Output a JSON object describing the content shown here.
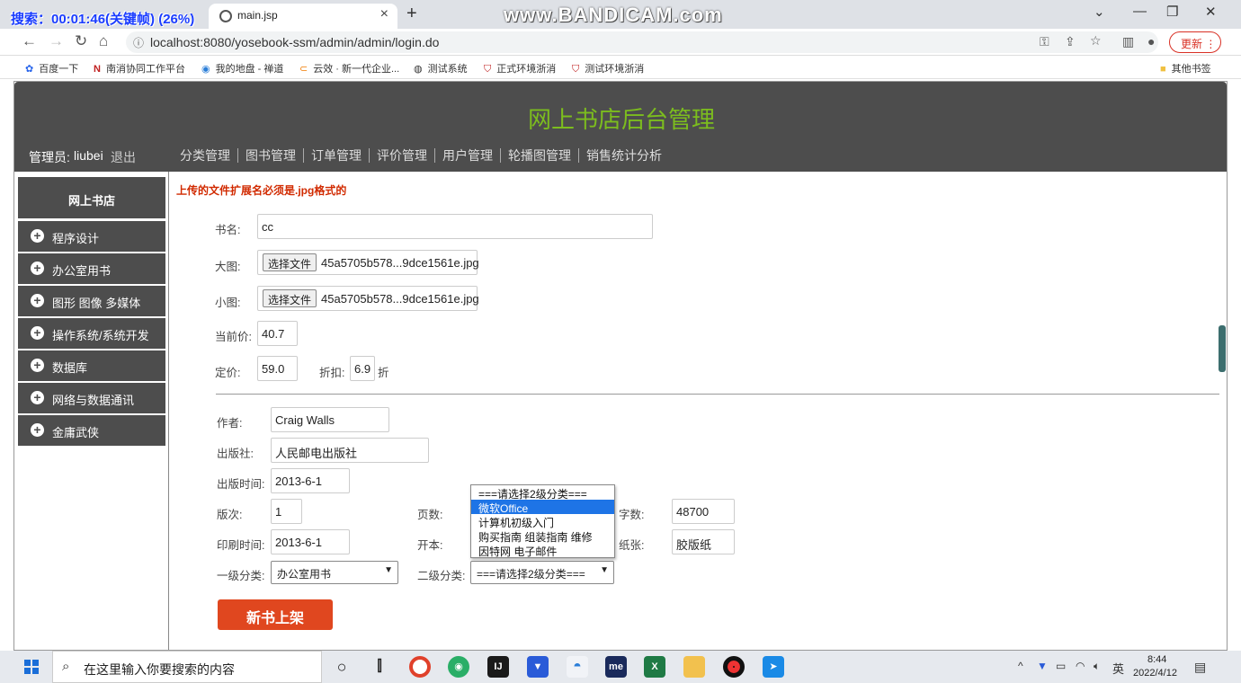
{
  "browser": {
    "recording_overlay": "搜索：00:01:46(关键帧) (26%)",
    "watermark": "www.BANDICAM.com",
    "tab_title": "main.jsp",
    "url": "localhost:8080/yosebook-ssm/admin/admin/login.do",
    "update_label": "更新",
    "bookmarks": [
      "百度一下",
      "南消协同工作平台",
      "我的地盘 - 禅道",
      "云效 · 新一代企业...",
      "测试系统",
      "正式环境浙消",
      "测试环境浙消"
    ],
    "other_bookmarks": "其他书签"
  },
  "header": {
    "title": "网上书店后台管理",
    "admin_label": "管理员:",
    "admin_name": "liubei",
    "logout": "退出",
    "nav": [
      "分类管理",
      "图书管理",
      "订单管理",
      "评价管理",
      "用户管理",
      "轮播图管理",
      "销售统计分析"
    ]
  },
  "sidebar": {
    "title": "网上书店",
    "items": [
      "程序设计",
      "办公室用书",
      "图形 图像 多媒体",
      "操作系统/系统开发",
      "数据库",
      "网络与数据通讯",
      "金庸武侠"
    ]
  },
  "form": {
    "notice": "上传的文件扩展名必须是.jpg格式的",
    "book_name_label": "书名:",
    "book_name": "cc",
    "big_image_label": "大图:",
    "small_image_label": "小图:",
    "choose_file": "选择文件",
    "big_image_file": "45a5705b578...9dce1561e.jpg",
    "small_image_file": "45a5705b578...9dce1561e.jpg",
    "current_price_label": "当前价:",
    "current_price": "40.7",
    "list_price_label": "定价:",
    "list_price": "59.0",
    "discount_label": "折扣:",
    "discount": "6.9",
    "discount_unit": "折",
    "author_label": "作者:",
    "author": "Craig Walls",
    "publisher_label": "出版社:",
    "publisher": "人民邮电出版社",
    "publish_date_label": "出版时间:",
    "publish_date": "2013-6-1",
    "edition_label": "版次:",
    "edition": "1",
    "pages_label": "页数:",
    "words_label": "字数:",
    "words": "48700",
    "print_date_label": "印刷时间:",
    "print_date": "2013-6-1",
    "format_label": "开本:",
    "paper_label": "纸张:",
    "paper": "胶版纸",
    "category1_label": "一级分类:",
    "category1": "办公室用书",
    "category2_label": "二级分类:",
    "category2": "===请选择2级分类===",
    "category2_options": [
      "===请选择2级分类===",
      "微软Office",
      "计算机初级入门",
      "购买指南 组装指南 维修",
      "因特网 电子邮件"
    ],
    "category2_highlighted_index": 1,
    "submit_label": "新书上架"
  },
  "taskbar": {
    "search_placeholder": "在这里输入你要搜索的内容",
    "ime": "英",
    "time": "8:44",
    "date": "2022/4/12"
  },
  "colors": {
    "header_bg": "#4d4d4d",
    "title_green": "#7cbd1e",
    "notice_red": "#d12a00",
    "submit_bg": "#e0471f",
    "dropdown_highlight": "#1e74e6"
  }
}
